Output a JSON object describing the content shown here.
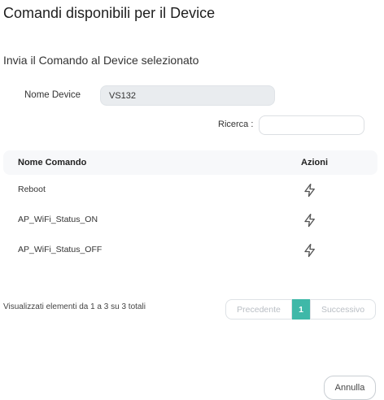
{
  "modal": {
    "title": "Comandi disponibili per il Device",
    "subtitle": "Invia il Comando al Device selezionato"
  },
  "device": {
    "label": "Nome Device",
    "value": "VS132"
  },
  "search": {
    "label": "Ricerca :",
    "value": ""
  },
  "table": {
    "headers": {
      "name": "Nome Comando",
      "actions": "Azioni"
    },
    "rows": [
      {
        "name": "Reboot",
        "action_icon": "lightning-icon"
      },
      {
        "name": "AP_WiFi_Status_ON",
        "action_icon": "lightning-icon"
      },
      {
        "name": "AP_WiFi_Status_OFF",
        "action_icon": "lightning-icon"
      }
    ]
  },
  "info": "Visualizzati elementi da 1 a 3 su 3 totali",
  "pagination": {
    "previous": "Precedente",
    "current": "1",
    "next": "Successivo"
  },
  "footer": {
    "cancel": "Annulla"
  },
  "colors": {
    "accent": "#3fb8a8"
  }
}
